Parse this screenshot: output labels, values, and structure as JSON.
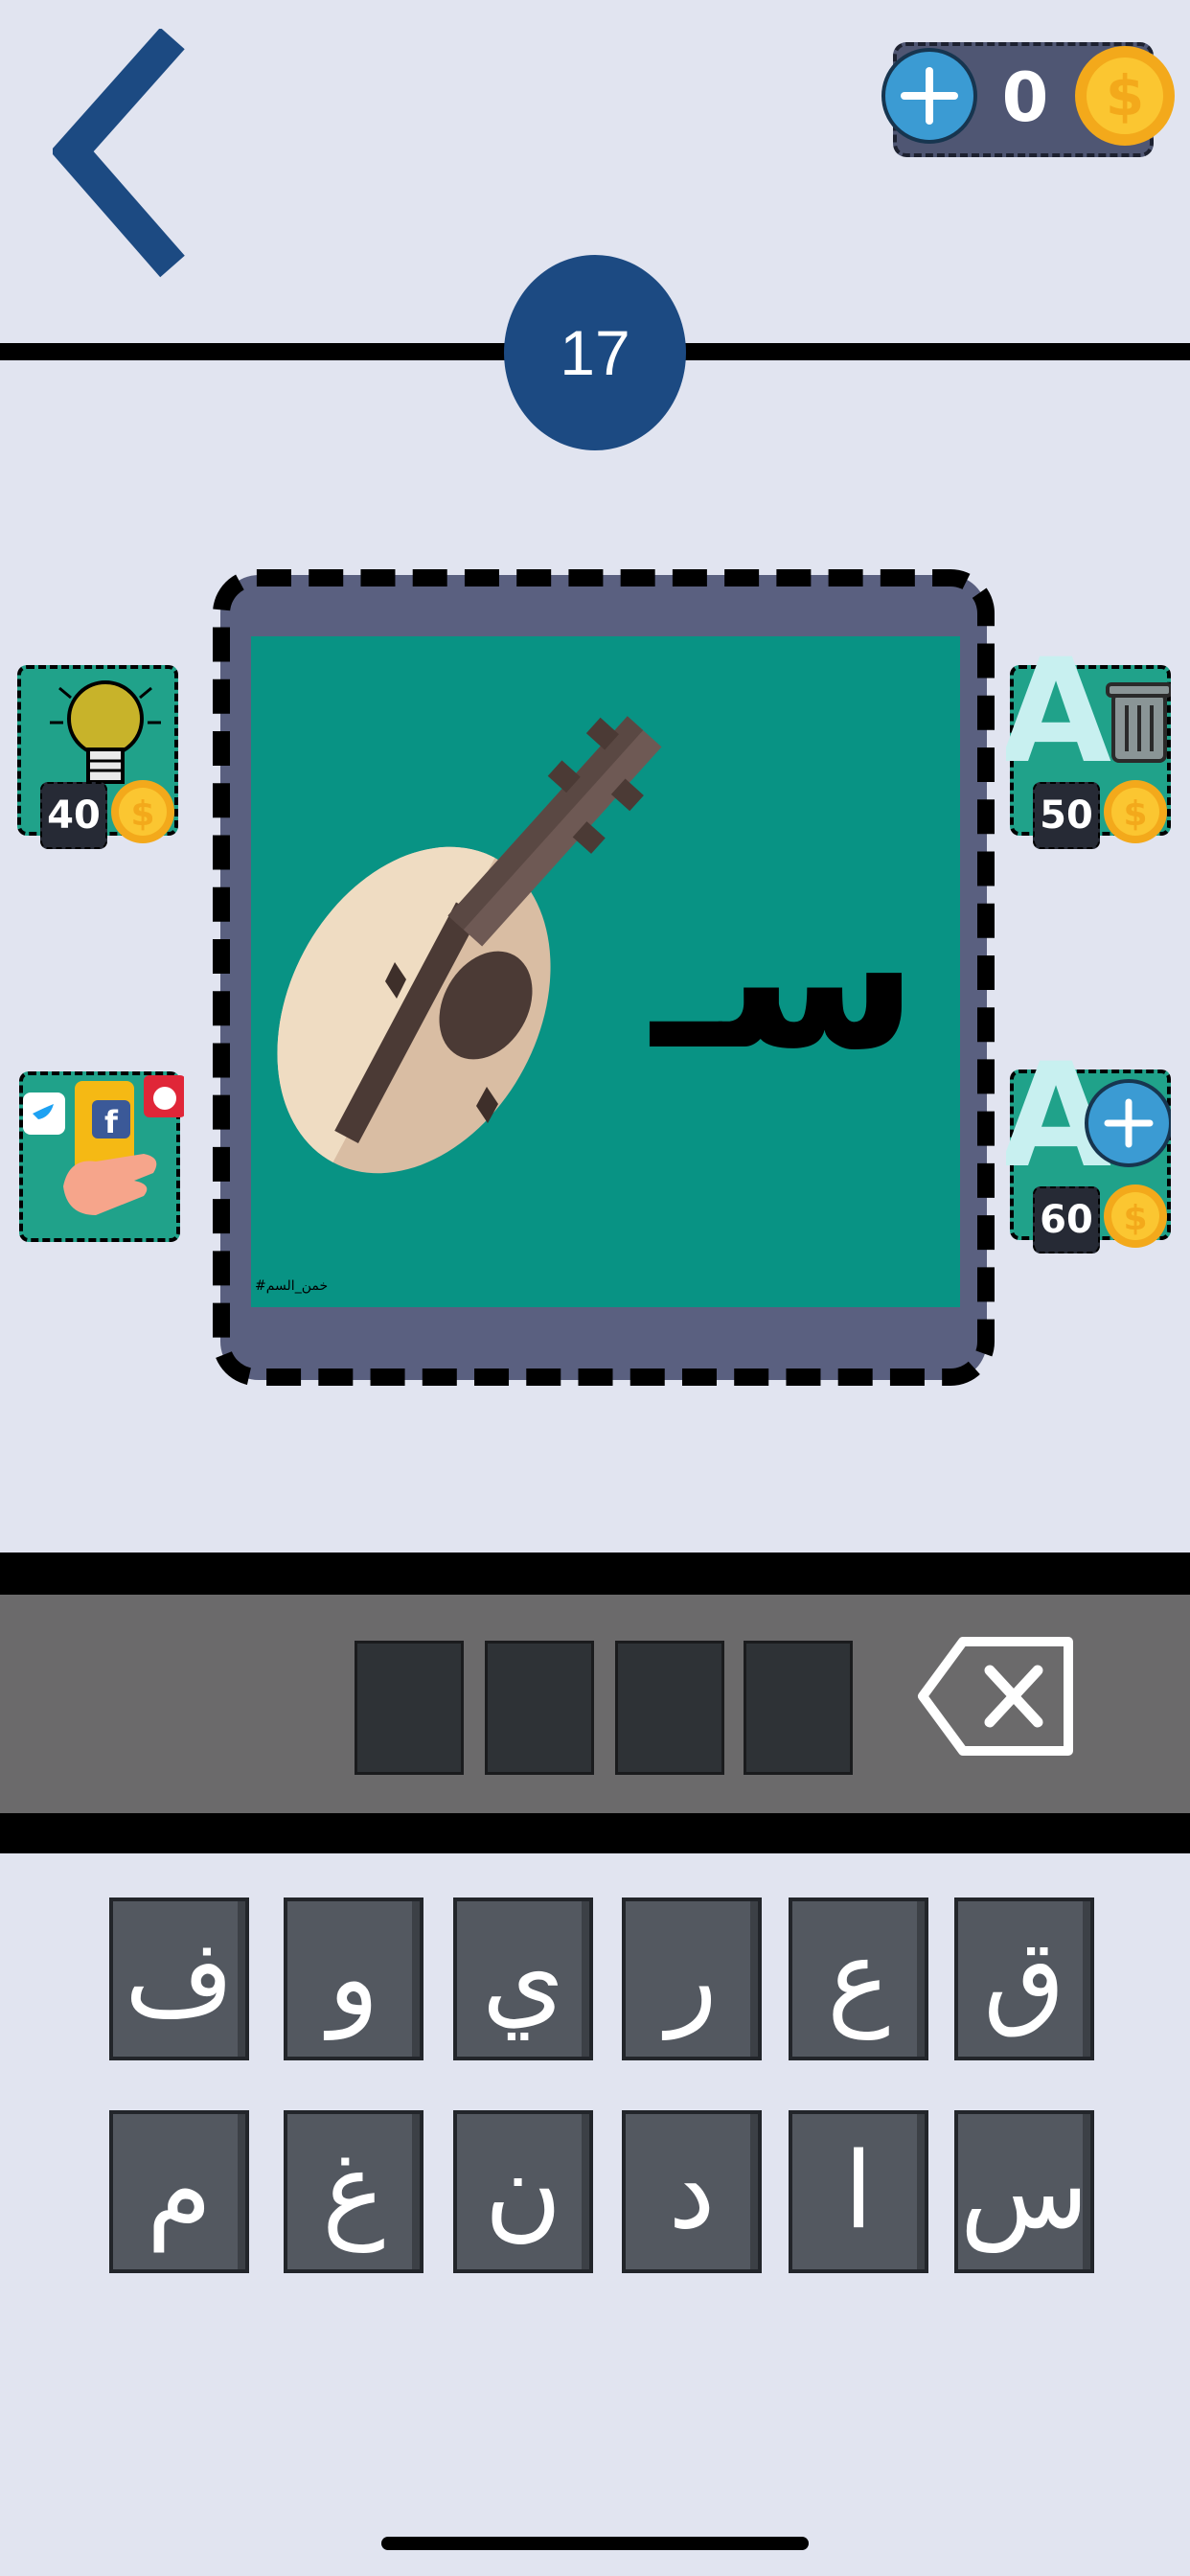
{
  "header": {
    "coins": "0",
    "level": "17"
  },
  "puzzle": {
    "clue_letters": "سـ",
    "watermark": "#خمن_السم"
  },
  "helpers": {
    "hint_cost": "40",
    "remove_letter_cost": "50",
    "reveal_letter_cost": "60"
  },
  "answer": {
    "slots": [
      "",
      "",
      "",
      ""
    ]
  },
  "keyboard": {
    "row1": [
      "ف",
      "و",
      "ي",
      "ر",
      "ع",
      "ق"
    ],
    "row2": [
      "م",
      "غ",
      "ن",
      "د",
      "ا",
      "س"
    ]
  },
  "colors": {
    "background": "#e1e4f0",
    "level_badge": "#1c4a82",
    "puzzle_bg": "#089384",
    "helper_bg": "#20a28a",
    "key_bg": "#535860"
  }
}
